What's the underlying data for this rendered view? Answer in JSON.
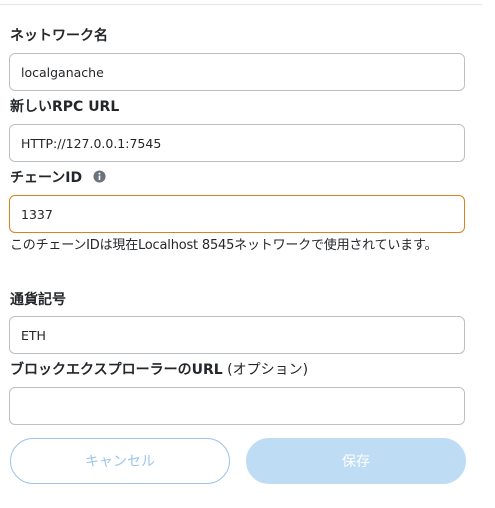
{
  "form": {
    "network_name": {
      "label": "ネットワーク名",
      "value": "localganache"
    },
    "rpc_url": {
      "label": "新しいRPC URL",
      "value": "HTTP://127.0.0.1:7545"
    },
    "chain_id": {
      "label": "チェーンID",
      "info_icon": "info-icon",
      "value": "1337",
      "warning": "このチェーンIDは現在Localhost 8545ネットワークで使用されています。"
    },
    "currency_symbol": {
      "label": "通貨記号",
      "value": "ETH"
    },
    "explorer_url": {
      "label": "ブロックエクスプローラーのURL",
      "label_optional": " (オプション)",
      "value": ""
    }
  },
  "buttons": {
    "cancel_label": "キャンセル",
    "save_label": "保存"
  },
  "colors": {
    "warning_border": "#d9821e",
    "primary_disabled": "#bedcf3",
    "secondary_border": "#9cc6ea",
    "text": "#24272a"
  }
}
